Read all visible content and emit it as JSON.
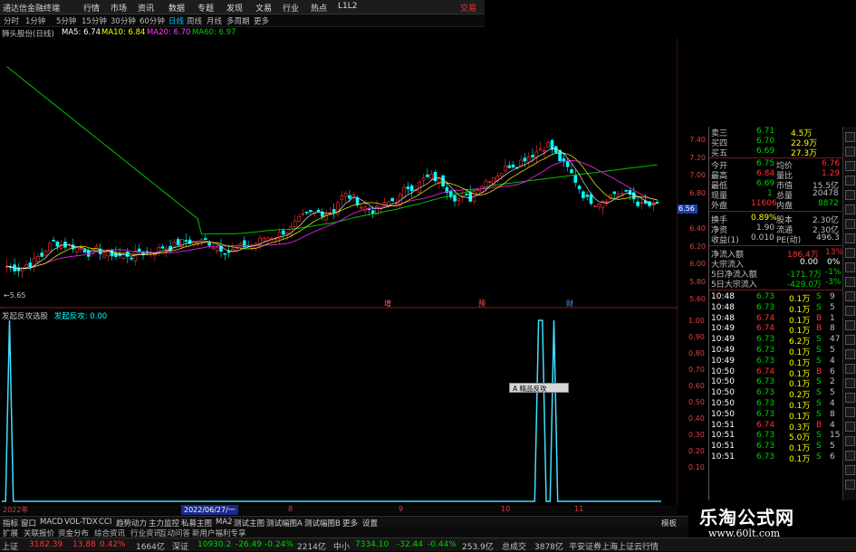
{
  "menubar": {
    "title": "通达信金融终端",
    "items": [
      "行情",
      "市场",
      "资讯",
      "数据",
      "专题",
      "发现",
      "文易",
      "行业",
      "热点",
      "L1L2"
    ],
    "trade_label": "交易"
  },
  "periods": [
    "分时",
    "1分钟",
    "5分钟",
    "15分钟",
    "30分钟",
    "60分钟",
    "日线",
    "周线",
    "月线",
    "多周期",
    "更多"
  ],
  "active_period": "日线",
  "ma_line": {
    "stock": "狮头股份(日线)",
    "ma5": "MA5: 6.74",
    "ma10": "MA10: 6.84",
    "ma20": "MA20: 6.70",
    "ma60": "MA60: 6.97"
  },
  "price_axis": [
    "7.40",
    "7.20",
    "7.00",
    "6.80",
    "6.60",
    "6.40",
    "6.20",
    "6.00",
    "5.80",
    "5.60"
  ],
  "cursor_price": "6.56",
  "low_marker": "5.65",
  "event_marks": [
    "增",
    "预",
    "财"
  ],
  "indicator": {
    "name": "发起反攻选股",
    "signal_label": "发起反攻: 0.00",
    "axis": [
      "1.00",
      "0.90",
      "0.80",
      "0.70",
      "0.60",
      "0.50",
      "0.40",
      "0.30",
      "0.20",
      "0.10"
    ],
    "tooltip": "A 精品反攻",
    "signal_values": [
      0,
      0,
      1,
      0,
      0,
      0,
      0,
      0,
      0,
      0,
      0,
      0,
      0,
      0,
      0,
      0,
      0,
      0,
      0,
      0,
      0,
      0,
      0,
      0,
      0,
      0,
      0,
      0,
      0,
      0,
      0,
      0,
      0,
      0,
      0,
      0,
      0,
      0,
      0,
      0,
      0,
      0,
      0,
      0,
      0,
      0,
      0,
      0,
      0,
      0,
      0,
      0,
      0,
      0,
      0,
      0,
      0,
      0,
      0,
      0,
      0,
      0,
      0,
      0,
      0,
      0,
      0,
      0,
      0,
      0,
      0,
      0,
      0,
      0,
      0,
      0,
      0,
      0,
      0,
      0,
      0,
      0,
      0,
      0,
      0,
      0,
      0,
      0,
      0,
      0,
      0,
      0,
      0,
      0,
      0,
      0,
      0,
      0,
      0,
      0,
      0,
      0,
      0,
      0,
      0,
      0,
      0,
      0,
      0,
      0,
      0,
      0,
      0,
      0,
      0,
      0,
      0,
      0,
      0,
      0,
      0,
      0,
      0,
      0,
      0,
      0,
      0,
      0,
      0,
      0,
      0,
      0,
      0,
      0,
      0,
      0,
      0,
      0,
      0,
      0,
      1,
      1,
      0,
      0,
      1,
      0,
      0,
      0,
      0,
      0,
      0,
      0,
      0,
      0,
      0,
      0,
      0,
      0,
      0,
      0,
      0,
      0,
      0,
      0,
      0,
      0,
      0,
      0,
      0,
      0,
      0,
      0,
      0
    ]
  },
  "date_axis": [
    "2022年",
    "8",
    "9",
    "10",
    "11"
  ],
  "cursor_date": "2022/06/27/一",
  "tabs": [
    "指标",
    "窗口",
    "MACD",
    "VOL-TDX",
    "CCI",
    "趋势动力",
    "主力监控",
    "私募主图",
    "MA2",
    "测试主图",
    "测试幅图A",
    "测试幅图B",
    "更多",
    "设置"
  ],
  "tabs_right": "模板",
  "tabs2": [
    "扩展",
    "关联报价",
    "资金分布",
    "综合资讯",
    "行业资讯",
    "互动问答",
    "新用户福利专享"
  ],
  "quote": {
    "ask": [
      {
        "label": "卖三",
        "price": "6.71",
        "vol": "4.5万"
      },
      {
        "label": "买四",
        "price": "6.70",
        "vol": "22.9万"
      },
      {
        "label": "买五",
        "price": "6.69",
        "vol": "27.3万"
      }
    ],
    "stats": [
      {
        "l1": "今开",
        "v1": "6.75",
        "l2": "均价",
        "v2": "6.76"
      },
      {
        "l1": "最高",
        "v1": "6.84",
        "l2": "量比",
        "v2": "1.29"
      },
      {
        "l1": "最低",
        "v1": "6.69",
        "l2": "市值",
        "v2": "15.5亿"
      },
      {
        "l1": "现量",
        "v1": "1",
        "l2": "总量",
        "v2": "20478"
      },
      {
        "l1": "外盘",
        "v1": "11606",
        "l2": "内盘",
        "v2": "8872"
      }
    ],
    "stats2": [
      {
        "l1": "换手",
        "v1": "0.89%",
        "l2": "股本",
        "v2": "2.30亿"
      },
      {
        "l1": "净资",
        "v1": "1.90",
        "l2": "流通",
        "v2": "2.30亿"
      },
      {
        "l1": "收益(1)",
        "v1": "0.010",
        "l2": "PE(动)",
        "v2": "496.3"
      }
    ],
    "flows": [
      {
        "label": "净流入额",
        "val": "186.4万",
        "pct": "13%"
      },
      {
        "label": "大宗流入",
        "val": "0.00",
        "pct": "0%"
      },
      {
        "label": "5日净流入额",
        "val": "-171.7万",
        "pct": "-1%"
      },
      {
        "label": "5日大宗流入",
        "val": "-429.0万",
        "pct": "-3%"
      }
    ],
    "ticks": [
      {
        "t": "10:48",
        "p": "6.73",
        "v": "0.1万",
        "d": "S",
        "n": "9"
      },
      {
        "t": "10:48",
        "p": "6.73",
        "v": "0.1万",
        "d": "S",
        "n": "5"
      },
      {
        "t": "10:48",
        "p": "6.74",
        "v": "0.1万",
        "d": "B",
        "n": "1"
      },
      {
        "t": "10:49",
        "p": "6.74",
        "v": "0.1万",
        "d": "B",
        "n": "8"
      },
      {
        "t": "10:49",
        "p": "6.73",
        "v": "6.2万",
        "d": "S",
        "n": "47"
      },
      {
        "t": "10:49",
        "p": "6.73",
        "v": "0.1万",
        "d": "S",
        "n": "5"
      },
      {
        "t": "10:49",
        "p": "6.73",
        "v": "0.1万",
        "d": "S",
        "n": "4"
      },
      {
        "t": "10:50",
        "p": "6.74",
        "v": "0.1万",
        "d": "B",
        "n": "6"
      },
      {
        "t": "10:50",
        "p": "6.73",
        "v": "0.1万",
        "d": "S",
        "n": "2"
      },
      {
        "t": "10:50",
        "p": "6.73",
        "v": "0.2万",
        "d": "S",
        "n": "5"
      },
      {
        "t": "10:50",
        "p": "6.73",
        "v": "0.1万",
        "d": "S",
        "n": "4"
      },
      {
        "t": "10:50",
        "p": "6.73",
        "v": "0.1万",
        "d": "S",
        "n": "8"
      },
      {
        "t": "10:51",
        "p": "6.74",
        "v": "0.3万",
        "d": "B",
        "n": "4"
      },
      {
        "t": "10:51",
        "p": "6.73",
        "v": "5.0万",
        "d": "S",
        "n": "15"
      },
      {
        "t": "10:51",
        "p": "6.73",
        "v": "0.1万",
        "d": "S",
        "n": "5"
      },
      {
        "t": "10:51",
        "p": "6.73",
        "v": "0.1万",
        "d": "S",
        "n": "6"
      }
    ]
  },
  "status": {
    "sh_label": "上证",
    "sh_val": "3182.39",
    "sh_chg": "13.88",
    "sh_pct": "0.42%",
    "sh_amt": "1664亿",
    "sz_label": "深证",
    "sz_val": "10930.2",
    "sz_chg": "-26.49",
    "sz_pct": "-0.24%",
    "sz_amt": "2214亿",
    "zx_label": "中小",
    "zx_val": "7334.10",
    "zx_chg": "-32.44",
    "zx_pct": "-0.44%",
    "zx_amt": "253.9亿",
    "total_label": "总成交",
    "total_val": "3878亿",
    "broker": "平安证券上海上证云行情"
  },
  "watermark": {
    "line1": "乐淘公式网",
    "line2": "www.60lt.com"
  },
  "colors": {
    "up": "#ff3232",
    "down": "#00ffff",
    "ma5": "#ffffff",
    "ma10": "#ffff00",
    "ma20": "#ff00ff",
    "ma60": "#00ff00"
  }
}
